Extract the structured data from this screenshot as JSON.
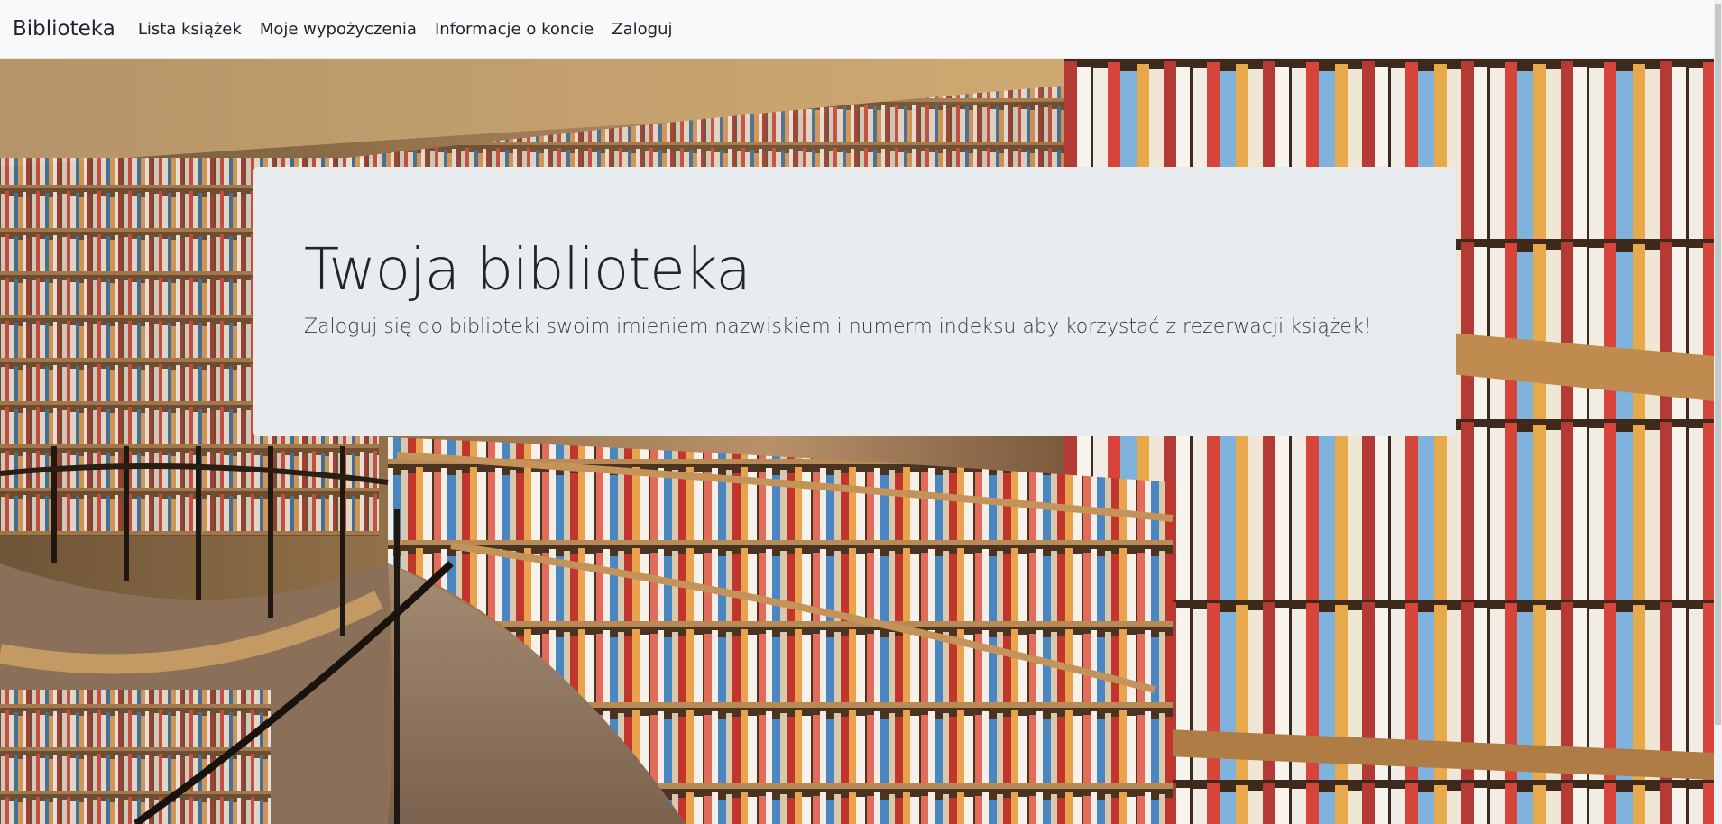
{
  "nav": {
    "brand": "Biblioteka",
    "links": [
      "Lista książek",
      "Moje wypożyczenia",
      "Informacje o koncie",
      "Zaloguj"
    ]
  },
  "hero": {
    "background_image": "library-bookshelves",
    "title": "Twoja biblioteka",
    "lead": "Zaloguj się do biblioteki swoim imieniem nazwiskiem i numerm indeksu aby korzystać z rezerwacji książek!"
  },
  "colors": {
    "navbar_bg": "#f8f9fa",
    "jumbotron_bg": "#e9ecef",
    "text": "#212529"
  }
}
